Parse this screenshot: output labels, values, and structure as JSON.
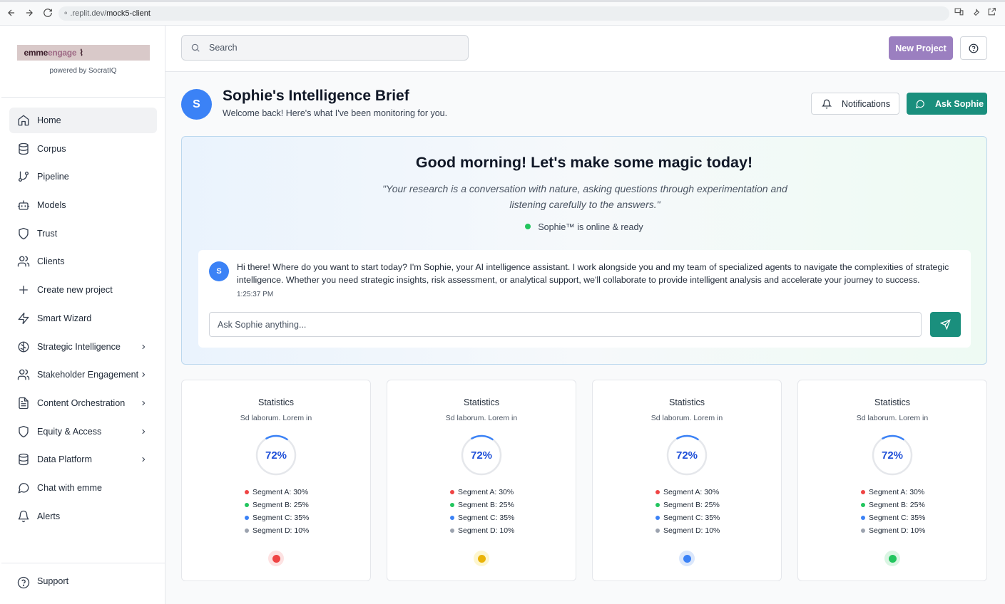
{
  "browser": {
    "url_prefix": ".replit.dev/",
    "url_path": "mock5-client"
  },
  "sidebar": {
    "logo_part1": "emme",
    "logo_part2": "engage",
    "powered_by": "powered by SocratIQ",
    "items": [
      {
        "label": "Home",
        "icon": "home-icon",
        "active": true
      },
      {
        "label": "Corpus",
        "icon": "database-icon"
      },
      {
        "label": "Pipeline",
        "icon": "git-branch-icon"
      },
      {
        "label": "Models",
        "icon": "bot-icon"
      },
      {
        "label": "Trust",
        "icon": "shield-icon"
      },
      {
        "label": "Clients",
        "icon": "users-icon"
      },
      {
        "label": "Create new project",
        "icon": "plus-icon"
      },
      {
        "label": "Smart Wizard",
        "icon": "zap-icon"
      },
      {
        "label": "Strategic Intelligence",
        "icon": "brain-icon",
        "expandable": true
      },
      {
        "label": "Stakeholder Engagement",
        "icon": "users-icon",
        "expandable": true
      },
      {
        "label": "Content Orchestration",
        "icon": "file-text-icon",
        "expandable": true
      },
      {
        "label": "Equity & Access",
        "icon": "shield-icon",
        "expandable": true
      },
      {
        "label": "Data Platform",
        "icon": "database-icon",
        "expandable": true
      },
      {
        "label": "Chat with emme",
        "icon": "message-circle-icon"
      },
      {
        "label": "Alerts",
        "icon": "bell-icon"
      }
    ],
    "support": "Support"
  },
  "topbar": {
    "search_placeholder": "Search",
    "new_project": "New Project"
  },
  "brief": {
    "avatar": "S",
    "title": "Sophie's Intelligence Brief",
    "subtitle": "Welcome back! Here's what I've been monitoring for you.",
    "notifications": "Notifications",
    "ask": "Ask Sophie"
  },
  "hero": {
    "title": "Good morning! Let's make some magic today!",
    "quote": "\"Your research is a conversation with nature, asking questions through experimentation and listening carefully to the answers.\"",
    "status": "Sophie™ is online & ready",
    "chat": {
      "avatar": "S",
      "message": "Hi there! Where do you want to start today? I'm Sophie, your AI intelligence assistant. I work alongside you and my team of specialized agents to navigate the complexities of strategic intelligence. Whether you need strategic insights, risk assessment, or analytical support, we'll collaborate to provide intelligent analysis and accelerate your journey to success.",
      "time": "1:25:37 PM",
      "input_placeholder": "Ask Sophie anything..."
    }
  },
  "cards": [
    {
      "title": "Statistics",
      "subtitle": "Sd laborum. Lorem in",
      "percent": "72%",
      "progress": 0.72,
      "indicator_color": "#ef4444",
      "indicator_bg": "#fde2e2"
    },
    {
      "title": "Statistics",
      "subtitle": "Sd laborum. Lorem in",
      "percent": "72%",
      "progress": 0.72,
      "indicator_color": "#eab308",
      "indicator_bg": "#fdf6cf"
    },
    {
      "title": "Statistics",
      "subtitle": "Sd laborum. Lorem in",
      "percent": "72%",
      "progress": 0.72,
      "indicator_color": "#3b82f6",
      "indicator_bg": "#dbe7fb"
    },
    {
      "title": "Statistics",
      "subtitle": "Sd laborum. Lorem in",
      "percent": "72%",
      "progress": 0.72,
      "indicator_color": "#22c55e",
      "indicator_bg": "#daf5e3"
    }
  ],
  "segments": [
    {
      "label": "Segment A: 30%",
      "color": "#ef4444"
    },
    {
      "label": "Segment B: 25%",
      "color": "#22c55e"
    },
    {
      "label": "Segment C: 35%",
      "color": "#3b82f6"
    },
    {
      "label": "Segment D: 10%",
      "color": "#9ca3af"
    }
  ]
}
